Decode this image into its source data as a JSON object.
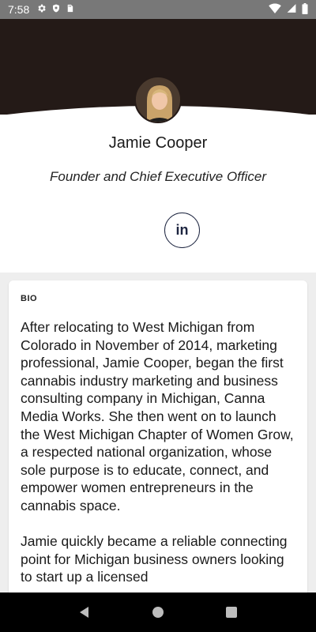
{
  "status_bar": {
    "time": "7:58",
    "icons_left": [
      "gear-icon",
      "shield-icon",
      "sd-card-icon"
    ],
    "icons_right": [
      "wifi-icon",
      "signal-icon",
      "battery-icon"
    ]
  },
  "profile": {
    "name": "Jamie Cooper",
    "title": "Founder and Chief Executive Officer",
    "linkedin_label": "in"
  },
  "bio": {
    "label": "BIO",
    "paragraphs": [
      "After relocating to West Michigan from Colorado in November of 2014, marketing professional, Jamie Cooper, began the first cannabis industry marketing and business consulting company in Michigan, Canna Media Works. She then went on to launch the West Michigan Chapter of Women Grow, a respected national organization, whose sole purpose is to educate, connect, and empower women entrepreneurs in the cannabis space.",
      "Jamie quickly became a reliable connecting point for Michigan business owners looking to start up a licensed"
    ]
  },
  "colors": {
    "header_bg": "#241a17",
    "status_bar_bg": "#787878",
    "linkedin": "#1d2540"
  },
  "nav_bar": {
    "buttons": [
      "back-icon",
      "home-icon",
      "recents-icon"
    ]
  }
}
